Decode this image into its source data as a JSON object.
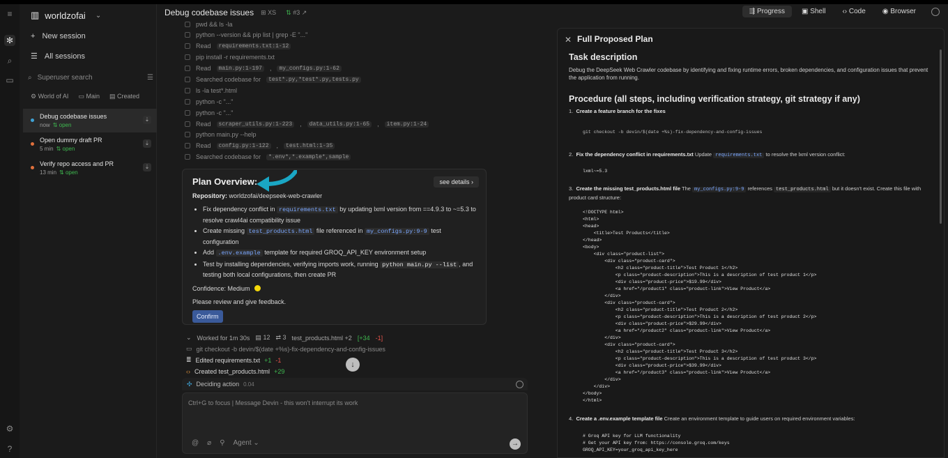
{
  "workspace": {
    "name": "worldzofai"
  },
  "sidebar": {
    "new_session": "New session",
    "all_sessions": "All sessions",
    "search_placeholder": "Superuser search",
    "filters": {
      "org": "World of AI",
      "branch": "Main",
      "sort": "Created"
    },
    "sessions": [
      {
        "title": "Debug codebase issues",
        "time": "now",
        "status": "open",
        "dot": "#3fa3d6"
      },
      {
        "title": "Open dummy draft PR",
        "time": "5 min",
        "status": "open",
        "dot": "#e0703c"
      },
      {
        "title": "Verify repo access and PR",
        "time": "13 min",
        "status": "open",
        "dot": "#e0703c"
      }
    ]
  },
  "header": {
    "title": "Debug codebase issues",
    "size": "XS",
    "pr": "#3",
    "tabs": [
      "Progress",
      "Shell",
      "Code",
      "Browser"
    ]
  },
  "timeline": {
    "t1": "pwd && ls -la",
    "t2": "python --version && pip list | grep -E \"...\"",
    "read1": "Read",
    "read1_file": "requirements.txt:1-12",
    "t4": "pip install -r requirements.txt",
    "read2": "Read",
    "read2_file1": "main.py:1-197",
    "read2_file2": "my_configs.py:1-62",
    "search1": "Searched codebase for",
    "search1_q": "test*.py,*test*.py,tests.py",
    "t7": "ls -la test*.html",
    "t8": "python -c \"...\"",
    "t9": "python -c \"...\"",
    "read3": "Read",
    "read3_f1": "scraper_utils.py:1-223",
    "read3_f2": "data_utils.py:1-65",
    "read3_f3": "item.py:1-24",
    "t11": "python main.py --help",
    "read4": "Read",
    "read4_f1": "config.py:1-122",
    "read4_f2": "test.html:1-35",
    "search2": "Searched codebase for",
    "search2_q": "*.env*,*.example*,sample"
  },
  "plan": {
    "title": "Plan Overview:",
    "see_details": "see details",
    "repo_label": "Repository:",
    "repo": "worldzofai/deepseek-web-crawler",
    "b1a": "Fix dependency conflict in",
    "b1code": "requirements.txt",
    "b1b": "by updating lxml version from ==4.9.3 to ~=5.3 to resolve crawl4ai compatibility issue",
    "b2a": "Create missing",
    "b2code1": "test_products.html",
    "b2b": "file referenced in",
    "b2code2": "my_configs.py:9-9",
    "b2c": "test configuration",
    "b3a": "Add",
    "b3code": ".env.example",
    "b3b": "template for required GROQ_API_KEY environment setup",
    "b4a": "Test by installing dependencies, verifying imports work, running",
    "b4code": "python main.py --list",
    "b4b": ", and testing both local configurations, then create PR",
    "confidence": "Confidence: Medium",
    "review": "Please review and give feedback.",
    "confirm": "Confirm"
  },
  "worked": {
    "label": "Worked for 1m 30s",
    "files": "12",
    "links": "3",
    "changes": "test_products.html +2",
    "added": "[+34",
    "removed": "-1]",
    "a1": "git checkout -b devin/$(date +%s)-fix-dependency-and-config-issues",
    "a2": "Edited requirements.txt",
    "a2_add": "+1",
    "a2_rem": "-1",
    "a3": "Created test_products.html",
    "a3_add": "+29"
  },
  "composer": {
    "deciding": "Deciding action",
    "deciding_time": "0.04",
    "placeholder": "Ctrl+G to focus | Message Devin - this won't interrupt its work",
    "agent": "Agent"
  },
  "panel": {
    "title": "Full Proposed Plan",
    "task_heading": "Task description",
    "task_desc": "Debug the DeepSeek Web Crawler codebase by identifying and fixing runtime errors, broken dependencies, and configuration issues that prevent the application from running.",
    "proc_heading": "Procedure (all steps, including verification strategy, git strategy if any)",
    "s1": "1.",
    "s1_title": "Create a feature branch for the fixes",
    "s1_code": "git checkout -b devin/$(date +%s)-fix-dependency-and-config-issues",
    "s2": "2.",
    "s2_title": "Fix the dependency conflict in requirements.txt",
    "s2_a": "Update",
    "s2_code": "requirements.txt",
    "s2_b": "to resolve the lxml version conflict:",
    "s2_val": "lxml~=5.3",
    "s3": "3.",
    "s3_title": "Create the missing test_products.html file",
    "s3_a": "The",
    "s3_code1": "my_configs.py:9-9",
    "s3_b": "references",
    "s3_code2": "test_products.html",
    "s3_c": "but it doesn't exist. Create this file with product card structure:",
    "html_lines": [
      "<!DOCTYPE html>",
      "<html>",
      "<head>",
      "    <title>Test Products</title>",
      "</head>",
      "<body>",
      "    <div class=\"product-list\">",
      "        <div class=\"product-card\">",
      "            <h2 class=\"product-title\">Test Product 1</h2>",
      "            <p class=\"product-description\">This is a description of test product 1</p>",
      "            <div class=\"product-price\">$19.99</div>",
      "            <a href=\"/product1\" class=\"product-link\">View Product</a>",
      "        </div>",
      "        <div class=\"product-card\">",
      "            <h2 class=\"product-title\">Test Product 2</h2>",
      "            <p class=\"product-description\">This is a description of test product 2</p>",
      "            <div class=\"product-price\">$29.99</div>",
      "            <a href=\"/product2\" class=\"product-link\">View Product</a>",
      "        </div>",
      "        <div class=\"product-card\">",
      "            <h2 class=\"product-title\">Test Product 3</h2>",
      "            <p class=\"product-description\">This is a description of test product 3</p>",
      "            <div class=\"product-price\">$39.99</div>",
      "            <a href=\"/product3\" class=\"product-link\">View Product</a>",
      "        </div>",
      "    </div>",
      "</body>",
      "</html>"
    ],
    "s4": "4.",
    "s4_title": "Create a .env.example template file",
    "s4_a": "Create an environment template to guide users on required environment variables:",
    "env_lines": [
      "# Groq API key for LLM functionality",
      "# Get your API key from: https://console.groq.com/keys",
      "GROQ_API_KEY=your_groq_api_key_here"
    ]
  }
}
